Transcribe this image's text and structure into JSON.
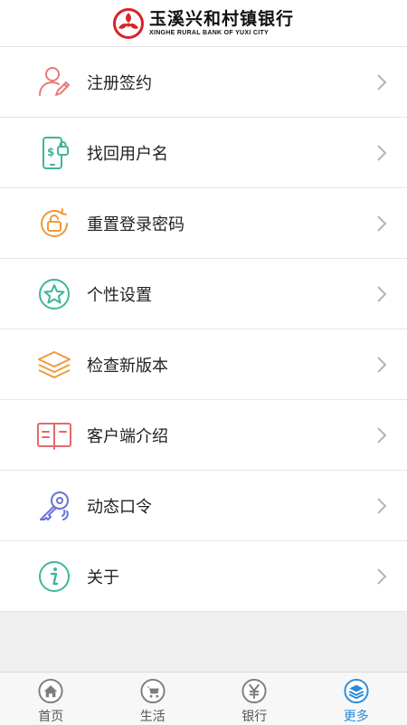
{
  "header": {
    "logo_cn": "玉溪兴和村镇银行",
    "logo_en": "XINGHE RURAL BANK OF YUXI CITY"
  },
  "menu": {
    "items": [
      {
        "label": "注册签约",
        "icon": "user-edit-icon",
        "color": "#e97a7a"
      },
      {
        "label": "找回用户名",
        "icon": "phone-dollar-lock-icon",
        "color": "#41b59a"
      },
      {
        "label": "重置登录密码",
        "icon": "lock-reset-icon",
        "color": "#ef9a3a"
      },
      {
        "label": "个性设置",
        "icon": "star-circle-icon",
        "color": "#3fb69a"
      },
      {
        "label": "检查新版本",
        "icon": "layers-icon",
        "color": "#ef9a3a"
      },
      {
        "label": "客户端介绍",
        "icon": "book-icon",
        "color": "#e36a6a"
      },
      {
        "label": "动态口令",
        "icon": "key-icon",
        "color": "#6a72d8"
      },
      {
        "label": "关于",
        "icon": "info-circle-icon",
        "color": "#3fb69a"
      }
    ]
  },
  "tabbar": {
    "tabs": [
      {
        "label": "首页",
        "icon": "home-icon",
        "active": false
      },
      {
        "label": "生活",
        "icon": "cart-icon",
        "active": false
      },
      {
        "label": "银行",
        "icon": "yuan-icon",
        "active": false
      },
      {
        "label": "更多",
        "icon": "layers-icon",
        "active": true
      }
    ]
  },
  "colors": {
    "accent": "#2a8ad7",
    "brand_red": "#d9232a"
  }
}
